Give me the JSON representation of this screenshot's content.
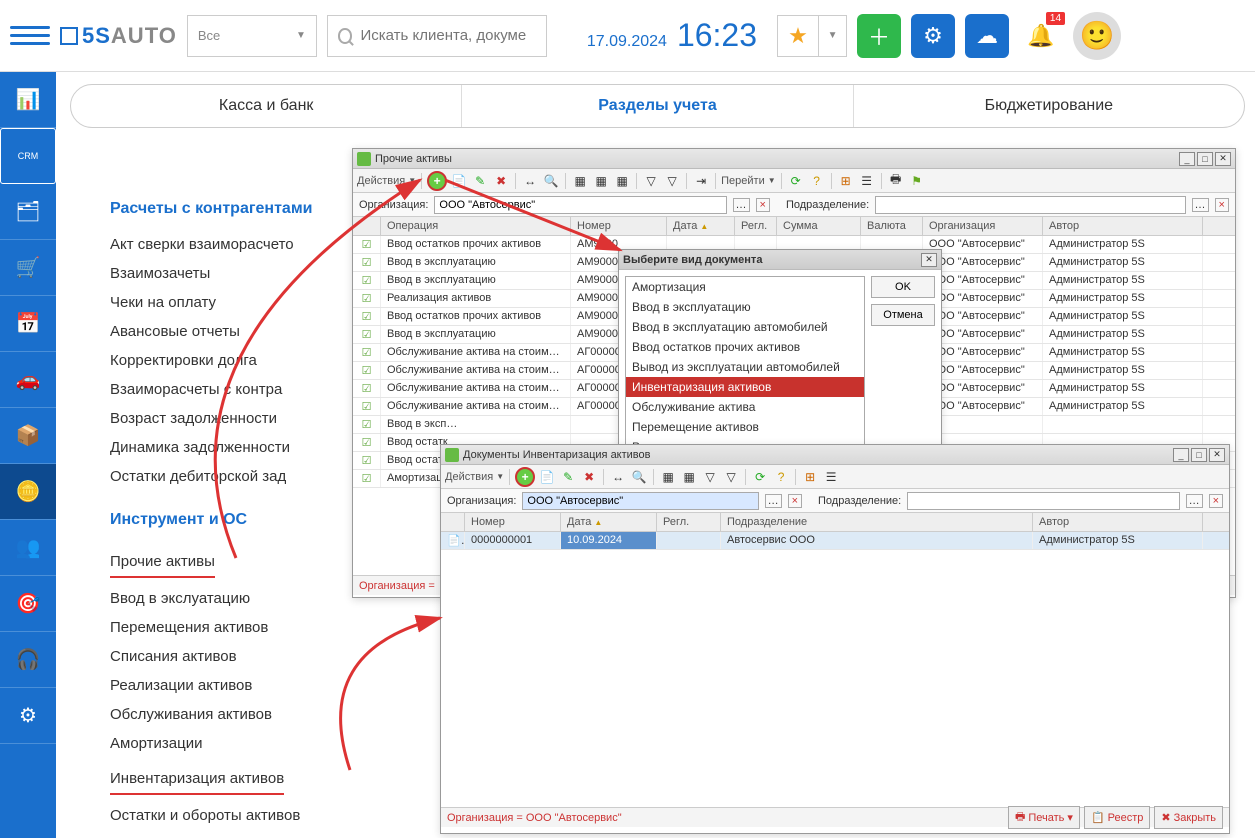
{
  "header": {
    "logo_blue": "5S",
    "logo_gray": "AUTO",
    "filter_all": "Все",
    "search_placeholder": "Искать клиента, докуме",
    "date": "17.09.2024",
    "time": "16:23",
    "badge_count": "14"
  },
  "tabs": {
    "t1": "Касса и банк",
    "t2": "Разделы учета",
    "t3": "Бюджетирование"
  },
  "leftnav": {
    "h1": "Расчеты с контрагентами",
    "g1": [
      "Акт сверки взаиморасчето",
      "Взаимозачеты",
      "Чеки на оплату",
      "Авансовые отчеты",
      "Корректировки долга",
      "Взаиморасчеты с контра",
      "Возраст задолженности",
      "Динамика задолженности",
      "Остатки дебиторской зад"
    ],
    "h2": "Инструмент и ОС",
    "g2": [
      "Прочие активы",
      "Ввод в экслуатацию",
      "Перемещения активов",
      "Списания активов",
      "Реализации активов",
      "Обслуживания активов",
      "Амортизации",
      "Инвентаризация активов",
      "Остатки и обороты активов"
    ]
  },
  "win1": {
    "title": "Прочие активы",
    "actions_label": "Действия",
    "goto_label": "Перейти",
    "org_label": "Организация:",
    "org_val": "ООО \"Автосервис\"",
    "dept_label": "Подразделение:",
    "status": "Организация =",
    "cols": [
      "",
      "Операция",
      "Номер",
      "Дата",
      "Регл.",
      "Сумма",
      "Валюта",
      "Организация",
      "Автор"
    ],
    "rows": [
      [
        "Ввод остатков прочих активов",
        "АМ9000",
        "",
        "",
        "",
        "",
        "ООО \"Автосервис\"",
        "Администратор 5S"
      ],
      [
        "Ввод в эксплуатацию",
        "АМ9000",
        "",
        "",
        "",
        "",
        "ООО \"Автосервис\"",
        "Администратор 5S"
      ],
      [
        "Ввод в эксплуатацию",
        "АМ9000",
        "",
        "",
        "",
        "",
        "ООО \"Автосервис\"",
        "Администратор 5S"
      ],
      [
        "Реализация активов",
        "АМ9000",
        "",
        "",
        "",
        "",
        "ООО \"Автосервис\"",
        "Администратор 5S"
      ],
      [
        "Ввод остатков прочих активов",
        "АМ9000",
        "",
        "",
        "",
        "",
        "ООО \"Автосервис\"",
        "Администратор 5S"
      ],
      [
        "Ввод в эксплуатацию",
        "АМ9000",
        "",
        "",
        "",
        "",
        "ООО \"Автосервис\"",
        "Администратор 5S"
      ],
      [
        "Обслуживание актива на стоимос…",
        "АГ00000",
        "",
        "",
        "",
        "",
        "ООО \"Автосервис\"",
        "Администратор 5S"
      ],
      [
        "Обслуживание актива на стоимос…",
        "АГ00000",
        "",
        "",
        "",
        "",
        "ООО \"Автосервис\"",
        "Администратор 5S"
      ],
      [
        "Обслуживание актива на стоимос…",
        "АГ00000",
        "",
        "",
        "",
        "",
        "ООО \"Автосервис\"",
        "Администратор 5S"
      ],
      [
        "Обслуживание актива на стоимос…",
        "АГ00000",
        "",
        "",
        "",
        "",
        "ООО \"Автосервис\"",
        "Администратор 5S"
      ],
      [
        "Ввод в эксп…",
        "",
        "",
        "",
        "",
        "",
        "",
        ""
      ],
      [
        "Ввод остатк",
        "",
        "",
        "",
        "",
        "",
        "",
        ""
      ],
      [
        "Ввод остатк",
        "",
        "",
        "",
        "",
        "",
        "",
        ""
      ],
      [
        "Амортизаци",
        "",
        "",
        "",
        "",
        "",
        "",
        ""
      ]
    ]
  },
  "win2": {
    "title": "Выберите вид документа",
    "ok": "OK",
    "cancel": "Отмена",
    "items": [
      "Амортизация",
      "Ввод в эксплуатацию",
      "Ввод в эксплуатацию автомобилей",
      "Ввод остатков прочих активов",
      "Вывод из эксплуатации автомобилей",
      "Инвентаризация активов",
      "Обслуживание актива",
      "Перемещение активов",
      "Реализация активов"
    ],
    "selected_index": 5
  },
  "win3": {
    "title": "Документы Инвентаризация активов",
    "actions_label": "Действия",
    "org_label": "Организация:",
    "org_val": "ООО \"Автосервис\"",
    "dept_label": "Подразделение:",
    "status": "Организация = ООО \"Автосервис\"",
    "cols": [
      "",
      "Номер",
      "Дата",
      "Регл.",
      "Подразделение",
      "Автор"
    ],
    "rows": [
      [
        "0000000001",
        "10.09.2024",
        "",
        "Автосервис ООО",
        "Администратор 5S"
      ]
    ],
    "btn_print": "Печать",
    "btn_reg": "Реестр",
    "btn_close": "Закрыть"
  }
}
